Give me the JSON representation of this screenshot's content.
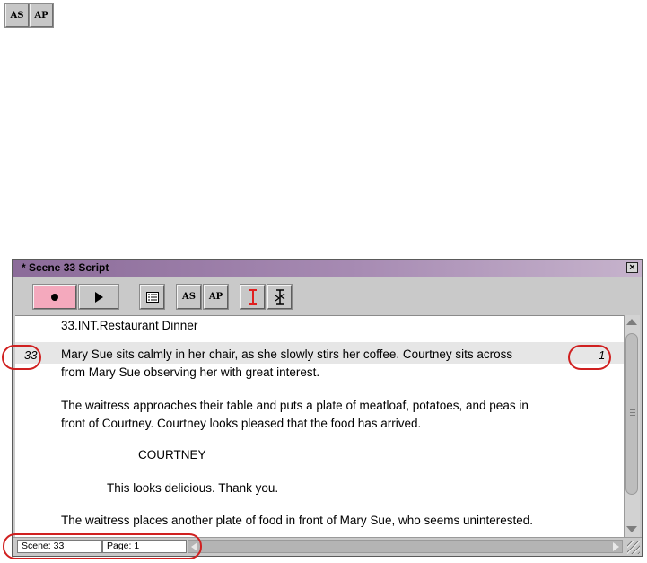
{
  "top_buttons": {
    "as_label": "AS",
    "ap_label": "AP"
  },
  "window": {
    "title": "* Scene 33 Script",
    "close_glyph": "×"
  },
  "toolbar": {
    "record_icon": "record-icon",
    "play_icon": "play-icon",
    "script_view_icon": "script-view-icon",
    "as_label": "AS",
    "ap_label": "AP",
    "insertion_icon": "text-cursor-icon",
    "insertion_active_color": "#e02020"
  },
  "script": {
    "scene_heading": "33.INT.Restaurant  Dinner",
    "scene_number_margin": "33",
    "take_number_margin": "1",
    "lines": [
      "Mary Sue sits calmly in her chair, as she slowly stirs her coffee.  Courtney sits across",
      "from Mary Sue observing her with great interest.",
      "The waitress approaches their table and puts a plate of meatloaf, potatoes, and peas in",
      "front of Courtney. Courtney looks pleased that the food has arrived.",
      "COURTNEY",
      "This looks delicious. Thank you.",
      "The waitress places another plate of food in front of Mary Sue, who seems uninterested."
    ]
  },
  "statusbar": {
    "scene": "Scene: 33",
    "page": "Page: 1"
  },
  "colors": {
    "titlebar_start": "#8b6b99",
    "titlebar_end": "#c6b3cc",
    "record_button": "#f4a9bd",
    "callout": "#d02020"
  }
}
